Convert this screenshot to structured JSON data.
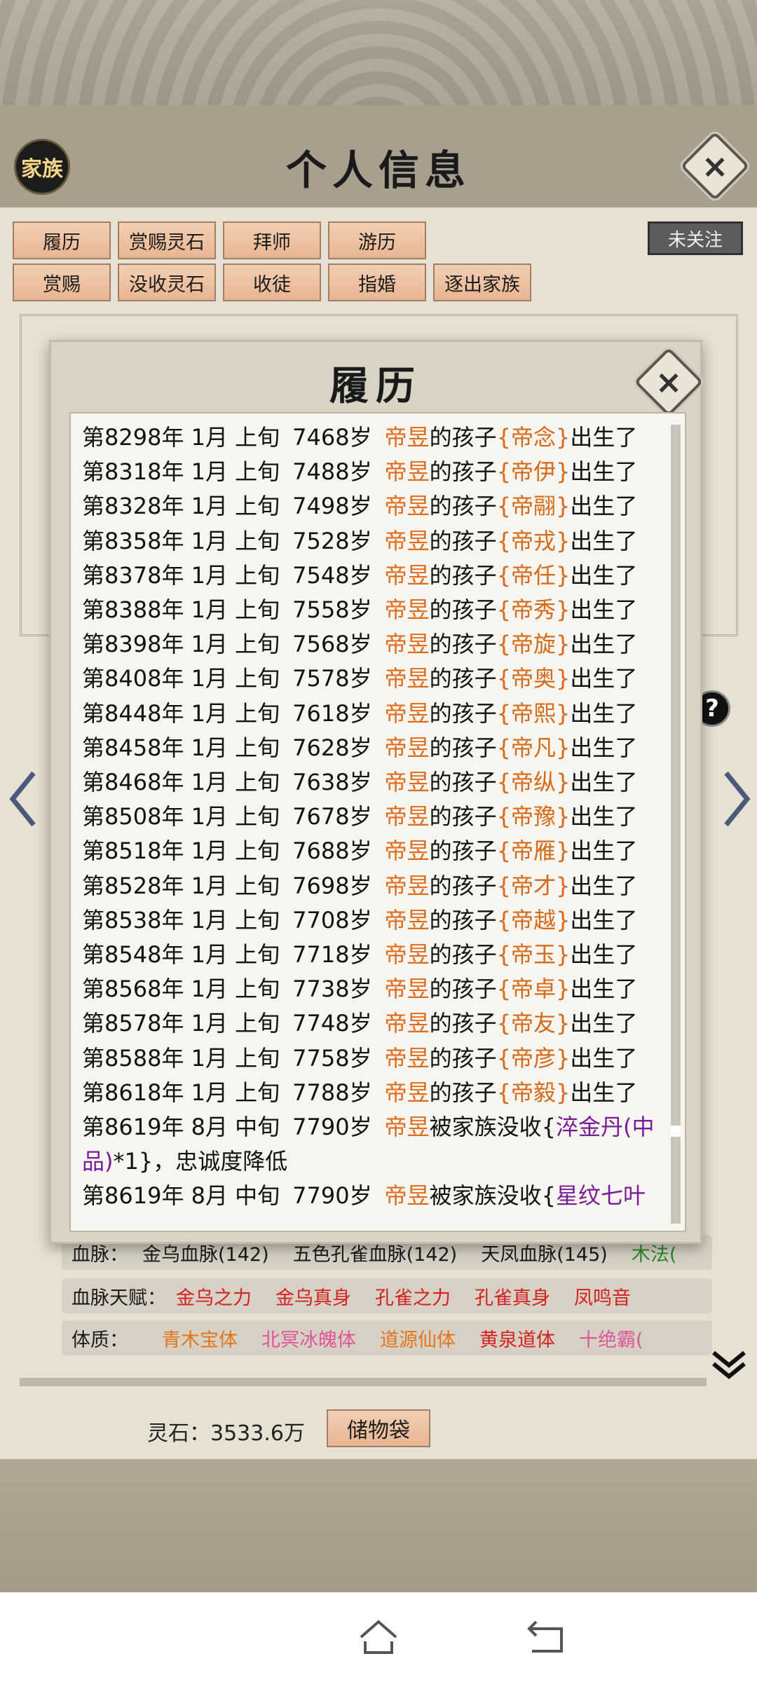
{
  "header": {
    "family_badge": "家族",
    "title": "个人信息",
    "close_icon": "close-icon"
  },
  "actions": {
    "row1": [
      "履历",
      "赏赐灵石",
      "拜师",
      "游历"
    ],
    "row2": [
      "赏赐",
      "没收灵石",
      "收徒",
      "指婚",
      "逐出家族"
    ],
    "follow": "未关注"
  },
  "stats": {
    "bloodline_label": "血脉：",
    "bloodlines": [
      "金乌血脉(142)",
      "五色孔雀血脉(142)",
      "天凤血脉(145)",
      "木法("
    ],
    "talent_label": "血脉天赋：",
    "talents": [
      "金乌之力",
      "金乌真身",
      "孔雀之力",
      "孔雀真身",
      "凤鸣音"
    ],
    "physique_label": "体质：",
    "physiques": [
      "青木宝体",
      "北冥冰魄体",
      "道源仙体",
      "黄泉道体",
      "十绝霸("
    ]
  },
  "footer": {
    "spirit_stone": "灵石：3533.6万",
    "bag_button": "储物袋"
  },
  "modal": {
    "title": "履历",
    "entries": [
      {
        "date": "第8298年 1月 上旬",
        "age": "7468岁",
        "name": "帝昱",
        "text": "的孩子",
        "child": "{帝念}",
        "end": "出生了"
      },
      {
        "date": "第8318年 1月 上旬",
        "age": "7488岁",
        "name": "帝昱",
        "text": "的孩子",
        "child": "{帝伊}",
        "end": "出生了"
      },
      {
        "date": "第8328年 1月 上旬",
        "age": "7498岁",
        "name": "帝昱",
        "text": "的孩子",
        "child": "{帝翮}",
        "end": "出生了"
      },
      {
        "date": "第8358年 1月 上旬",
        "age": "7528岁",
        "name": "帝昱",
        "text": "的孩子",
        "child": "{帝戎}",
        "end": "出生了"
      },
      {
        "date": "第8378年 1月 上旬",
        "age": "7548岁",
        "name": "帝昱",
        "text": "的孩子",
        "child": "{帝任}",
        "end": "出生了"
      },
      {
        "date": "第8388年 1月 上旬",
        "age": "7558岁",
        "name": "帝昱",
        "text": "的孩子",
        "child": "{帝秀}",
        "end": "出生了"
      },
      {
        "date": "第8398年 1月 上旬",
        "age": "7568岁",
        "name": "帝昱",
        "text": "的孩子",
        "child": "{帝旋}",
        "end": "出生了"
      },
      {
        "date": "第8408年 1月 上旬",
        "age": "7578岁",
        "name": "帝昱",
        "text": "的孩子",
        "child": "{帝奥}",
        "end": "出生了"
      },
      {
        "date": "第8448年 1月 上旬",
        "age": "7618岁",
        "name": "帝昱",
        "text": "的孩子",
        "child": "{帝熙}",
        "end": "出生了"
      },
      {
        "date": "第8458年 1月 上旬",
        "age": "7628岁",
        "name": "帝昱",
        "text": "的孩子",
        "child": "{帝凡}",
        "end": "出生了"
      },
      {
        "date": "第8468年 1月 上旬",
        "age": "7638岁",
        "name": "帝昱",
        "text": "的孩子",
        "child": "{帝纵}",
        "end": "出生了"
      },
      {
        "date": "第8508年 1月 上旬",
        "age": "7678岁",
        "name": "帝昱",
        "text": "的孩子",
        "child": "{帝豫}",
        "end": "出生了"
      },
      {
        "date": "第8518年 1月 上旬",
        "age": "7688岁",
        "name": "帝昱",
        "text": "的孩子",
        "child": "{帝雁}",
        "end": "出生了"
      },
      {
        "date": "第8528年 1月 上旬",
        "age": "7698岁",
        "name": "帝昱",
        "text": "的孩子",
        "child": "{帝才}",
        "end": "出生了"
      },
      {
        "date": "第8538年 1月 上旬",
        "age": "7708岁",
        "name": "帝昱",
        "text": "的孩子",
        "child": "{帝越}",
        "end": "出生了"
      },
      {
        "date": "第8548年 1月 上旬",
        "age": "7718岁",
        "name": "帝昱",
        "text": "的孩子",
        "child": "{帝玉}",
        "end": "出生了"
      },
      {
        "date": "第8568年 1月 上旬",
        "age": "7738岁",
        "name": "帝昱",
        "text": "的孩子",
        "child": "{帝卓}",
        "end": "出生了"
      },
      {
        "date": "第8578年 1月 上旬",
        "age": "7748岁",
        "name": "帝昱",
        "text": "的孩子",
        "child": "{帝友}",
        "end": "出生了"
      },
      {
        "date": "第8588年 1月 上旬",
        "age": "7758岁",
        "name": "帝昱",
        "text": "的孩子",
        "child": "{帝彦}",
        "end": "出生了"
      },
      {
        "date": "第8618年 1月 上旬",
        "age": "7788岁",
        "name": "帝昱",
        "text": "的孩子",
        "child": "{帝毅}",
        "end": "出生了"
      }
    ],
    "confiscations": [
      {
        "date": "第8619年 8月 中旬",
        "age": "7790岁",
        "name": "帝昱",
        "text": "被家族没收{",
        "item": "淬金丹(中品)",
        "end": "*1}，忠诚度降低"
      },
      {
        "date": "第8619年 8月 中旬",
        "age": "7790岁",
        "name": "帝昱",
        "text": "被家族没收{",
        "item": "星纹七叶",
        "end": ""
      }
    ]
  }
}
